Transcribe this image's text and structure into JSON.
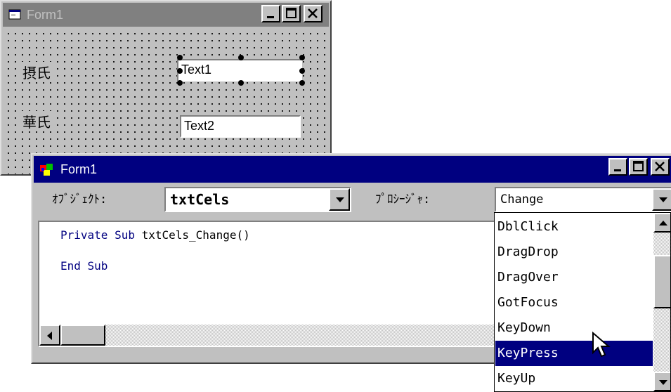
{
  "designer": {
    "title": "Form1",
    "label1": "摂氏",
    "label2": "華氏",
    "text1": "Text1",
    "text2": "Text2"
  },
  "code_window": {
    "title": "Form1",
    "object_label": "ｵﾌﾞｼﾞｪｸﾄ:",
    "object_value": "txtCels",
    "procedure_label": "ﾌﾟﾛｼｰｼﾞｬ:",
    "procedure_value": "Change",
    "code": {
      "line1_keyword": "Private Sub",
      "line1_rest": " txtCels_Change()",
      "line2": "End Sub"
    }
  },
  "procedure_list": {
    "items": [
      "DblClick",
      "DragDrop",
      "DragOver",
      "GotFocus",
      "KeyDown",
      "KeyPress",
      "KeyUp"
    ],
    "selected": "KeyPress"
  },
  "caption_buttons": {
    "minimize": "_",
    "maximize": "□",
    "close": "×"
  }
}
